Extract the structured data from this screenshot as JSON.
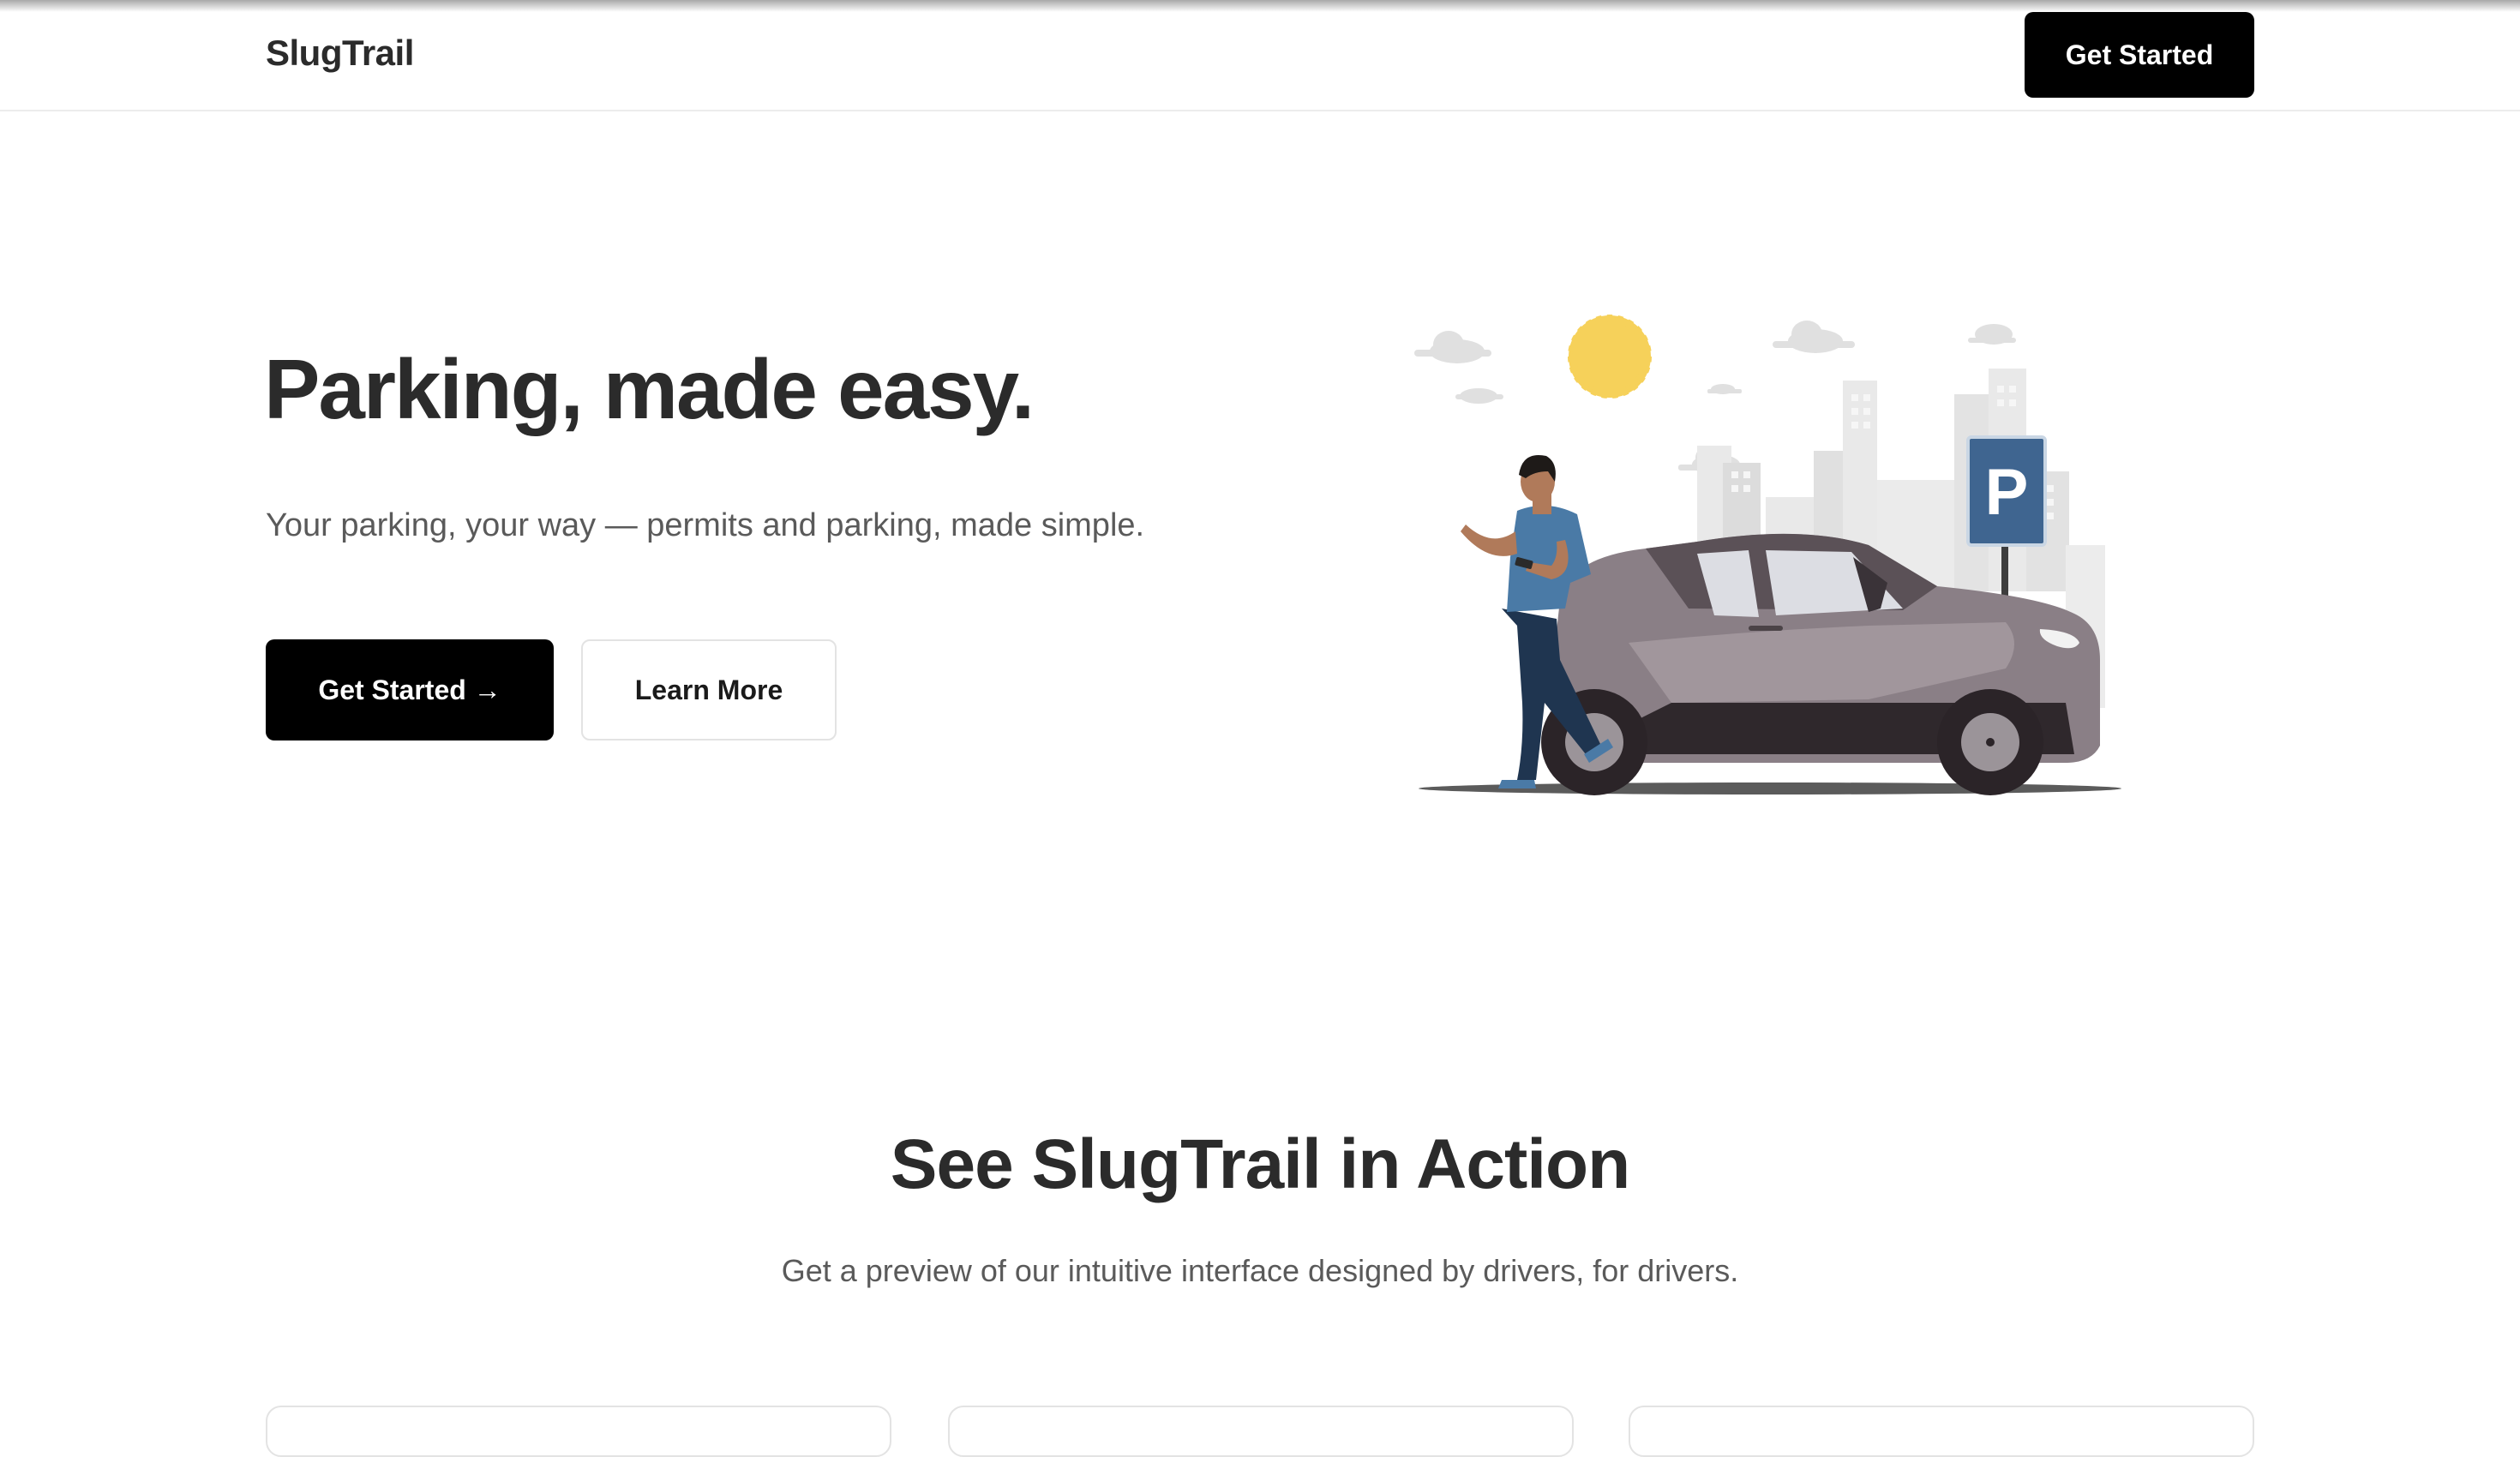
{
  "header": {
    "brand": "SlugTrail",
    "cta_label": "Get Started"
  },
  "hero": {
    "title": "Parking, made easy.",
    "subtitle": "Your parking, your way — permits and parking, made simple.",
    "primary_label": "Get Started →",
    "secondary_label": "Learn More",
    "illustration": {
      "sign_letter": "P",
      "colors": {
        "car": "#8a7f86",
        "sign": "#3f6590",
        "sun": "#f6d15a",
        "shirt": "#4a7aa6",
        "pants": "#1f3550",
        "buildings": "#e8e8e8"
      }
    }
  },
  "preview": {
    "title": "See SlugTrail in Action",
    "subtitle": "Get a preview of our intuitive interface designed by drivers, for drivers."
  },
  "colors": {
    "primary_button": "#000000",
    "text_dark": "#2b2b2b",
    "text_muted": "#5a5a5a",
    "border": "#e3e3e3"
  }
}
